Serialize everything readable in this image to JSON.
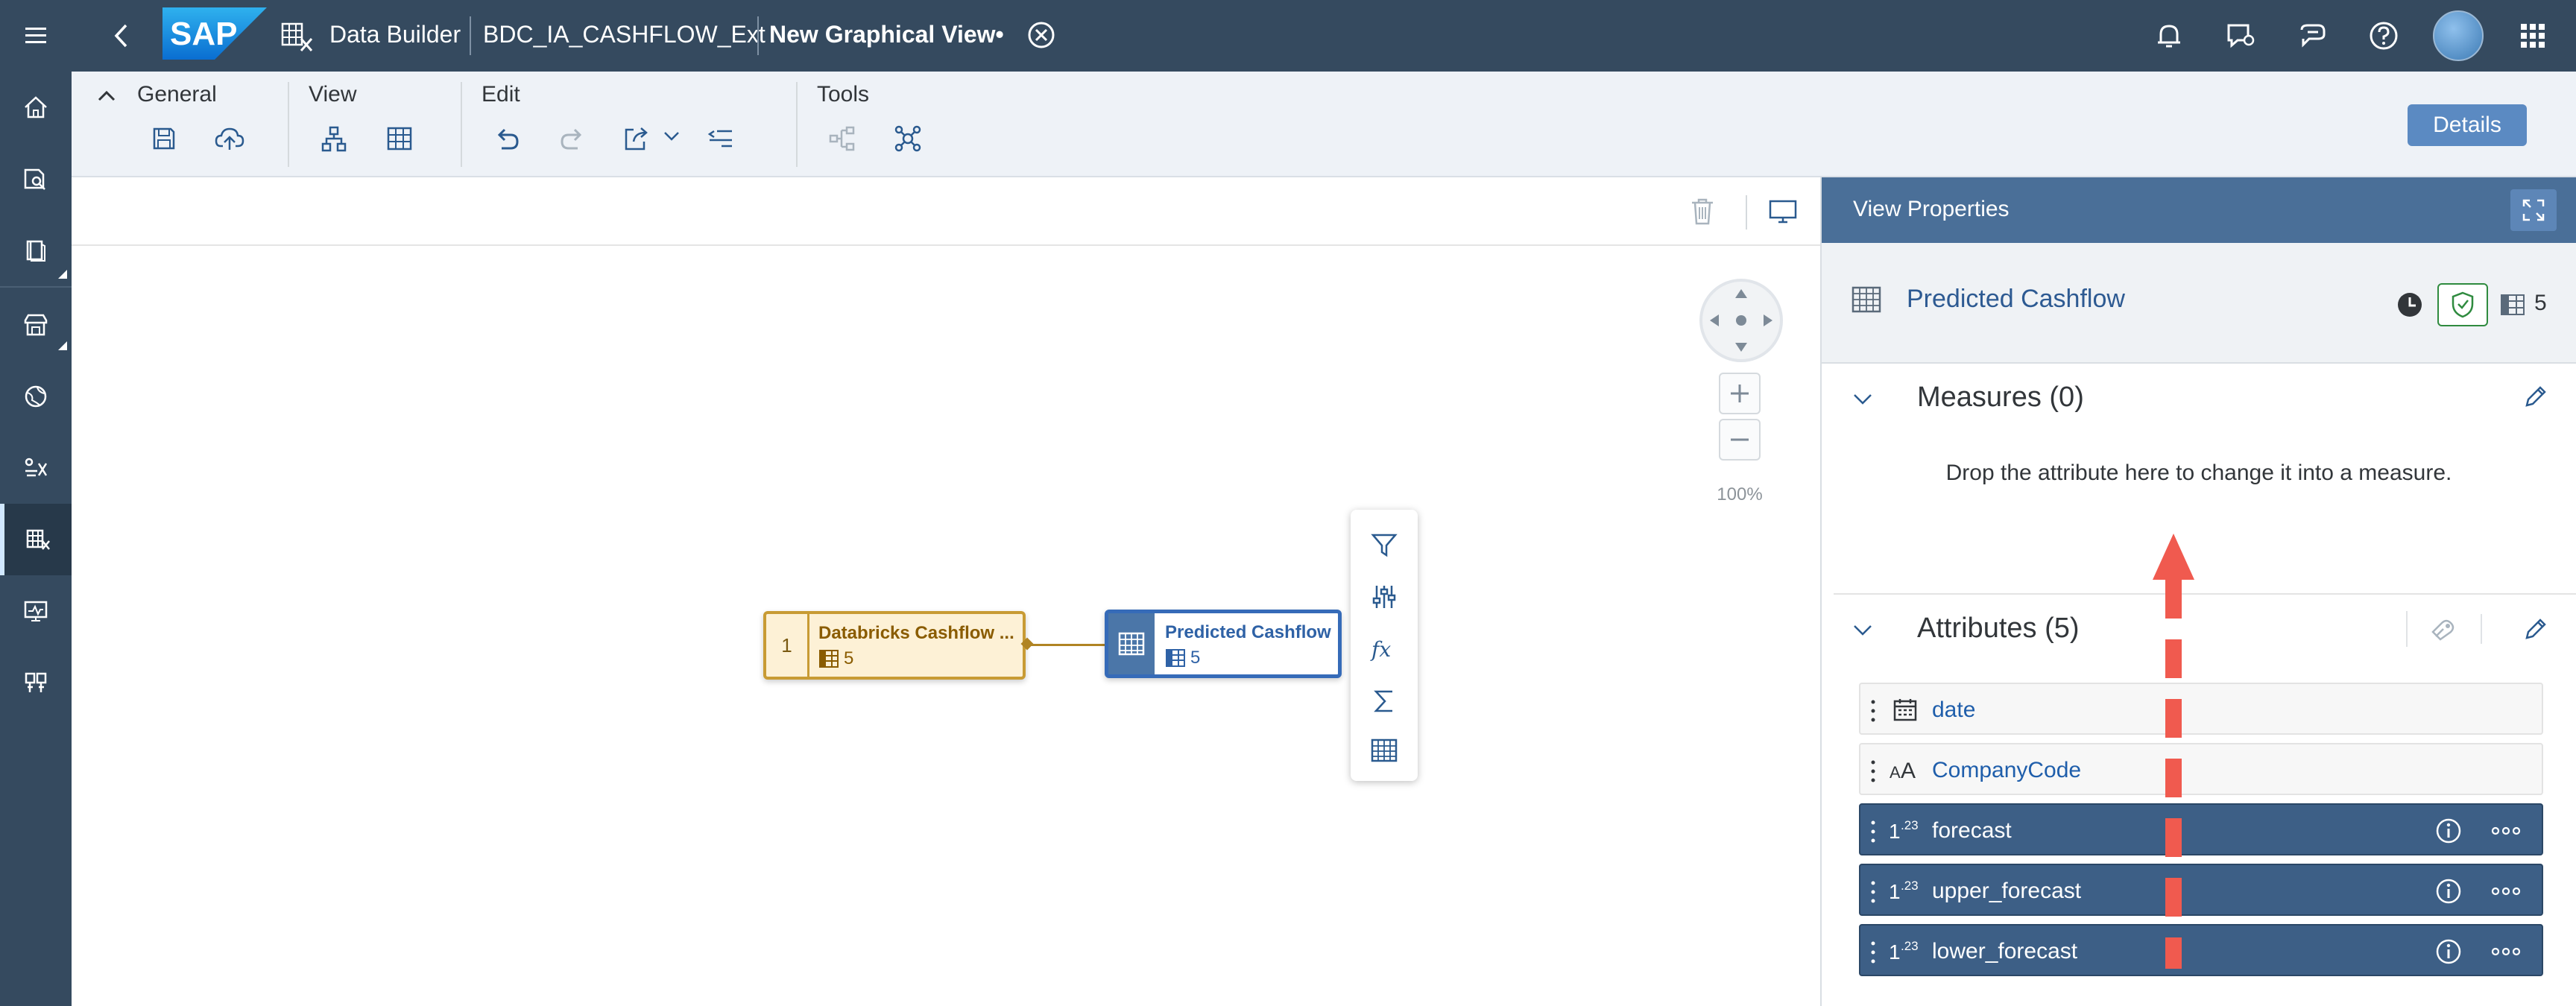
{
  "shell": {
    "app_name": "Data Builder",
    "space": "BDC_IA_CASHFLOW_Ext",
    "view_title": "New Graphical View•",
    "brand": "SAP"
  },
  "toolbar": {
    "general_label": "General",
    "view_label": "View",
    "edit_label": "Edit",
    "tools_label": "Tools",
    "details_label": "Details"
  },
  "canvas": {
    "source_node": {
      "index": "1",
      "title": "Databricks Cashflow ...",
      "count": "5"
    },
    "target_node": {
      "title": "Predicted Cashflow",
      "count": "5"
    },
    "zoom": "100%"
  },
  "panel": {
    "title": "View Properties",
    "object_name": "Predicted Cashflow",
    "column_count": "5",
    "measures_title": "Measures (0)",
    "measures_hint": "Drop the attribute here to change it into a measure.",
    "attributes_title": "Attributes (5)",
    "attributes": [
      {
        "name": "date",
        "type_icon": "calendar-icon",
        "selected": false
      },
      {
        "name": "CompanyCode",
        "type_icon": "string-type-icon",
        "selected": false
      },
      {
        "name": "forecast",
        "type_icon": "number-type-icon",
        "selected": true
      },
      {
        "name": "upper_forecast",
        "type_icon": "number-type-icon",
        "selected": true
      },
      {
        "name": "lower_forecast",
        "type_icon": "number-type-icon",
        "selected": true
      }
    ]
  },
  "colors": {
    "shell_bg": "#354a5f",
    "panel_header": "#4a6f98",
    "source_node_border": "#c89b34",
    "target_node_border": "#366bb8",
    "selected_row": "#3d5f86",
    "annotation_arrow": "#f05a4f"
  }
}
